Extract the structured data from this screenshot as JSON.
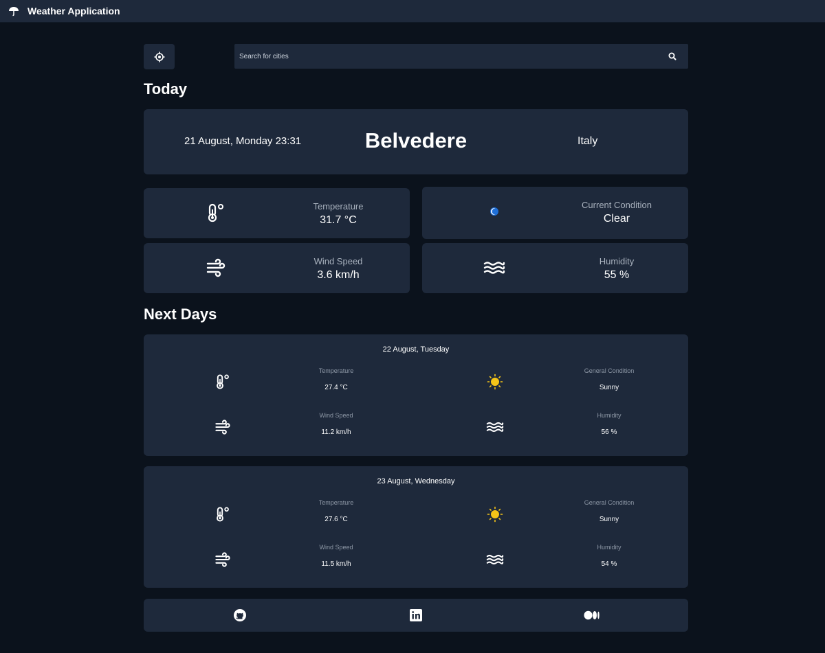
{
  "header": {
    "title": "Weather Application",
    "logo_icon": "umbrella-icon"
  },
  "search": {
    "placeholder": "Search for cities",
    "value": ""
  },
  "today": {
    "heading": "Today",
    "date": "21 August, Monday 23:31",
    "city": "Belvedere",
    "country": "Italy",
    "stats": {
      "temperature": {
        "label": "Temperature",
        "value": "31.7 °C",
        "icon": "thermometer-icon"
      },
      "condition": {
        "label": "Current Condition",
        "value": "Clear",
        "icon": "moon-icon"
      },
      "wind": {
        "label": "Wind Speed",
        "value": "3.6 km/h",
        "icon": "wind-icon"
      },
      "humidity": {
        "label": "Humidity",
        "value": "55 %",
        "icon": "waves-icon"
      }
    }
  },
  "next_days": {
    "heading": "Next Days",
    "days": [
      {
        "date": "22 August, Tuesday",
        "temperature": {
          "label": "Temperature",
          "value": "27.4 °C"
        },
        "condition": {
          "label": "General Condition",
          "value": "Sunny"
        },
        "wind": {
          "label": "Wind Speed",
          "value": "11.2 km/h"
        },
        "humidity": {
          "label": "Humidity",
          "value": "56 %"
        }
      },
      {
        "date": "23 August, Wednesday",
        "temperature": {
          "label": "Temperature",
          "value": "27.6 °C"
        },
        "condition": {
          "label": "General Condition",
          "value": "Sunny"
        },
        "wind": {
          "label": "Wind Speed",
          "value": "11.5 km/h"
        },
        "humidity": {
          "label": "Humidity",
          "value": "54 %"
        }
      }
    ]
  },
  "footer": {
    "links": [
      "github-icon",
      "linkedin-icon",
      "medium-icon"
    ]
  },
  "colors": {
    "background": "#0b121c",
    "card": "#1e293b",
    "sun": "#f5c518",
    "moon": "#1e6fd9"
  }
}
